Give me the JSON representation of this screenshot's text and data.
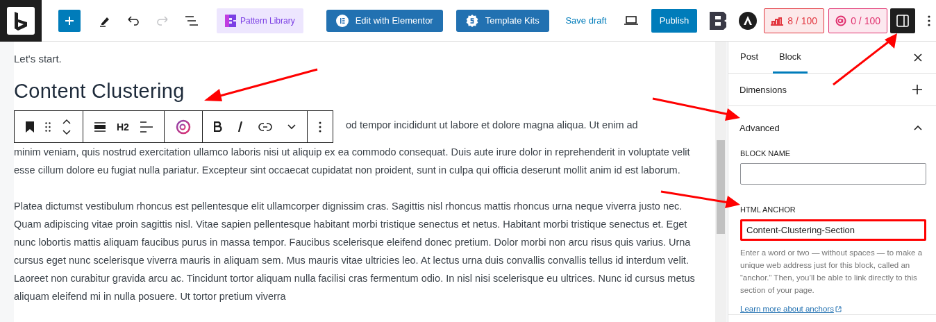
{
  "top_bar": {
    "pattern_library": "Pattern Library",
    "edit_with_elementor": "Edit with Elementor",
    "template_kits": "Template Kits",
    "save_draft": "Save draft",
    "publish": "Publish",
    "redo": {
      "disabled": true
    },
    "scores": [
      {
        "label": "8 / 100",
        "color": "#e2363f"
      },
      {
        "label": "0 / 100",
        "color": "#e0306e"
      }
    ],
    "settings_toggle": {
      "selected": true
    }
  },
  "editor": {
    "intro": "Let's start.",
    "heading": "Content Clustering",
    "block_toolbar": {
      "heading_level": "H2"
    },
    "text_beside_toolbar": "od tempor incididunt ut labore et dolore magna aliqua. Ut enim ad",
    "paragraphs": [
      "minim veniam, quis nostrud exercitation ullamco laboris nisi ut aliquip ex ea commodo consequat. Duis aute irure dolor in reprehenderit in voluptate velit esse cillum dolore eu fugiat nulla pariatur. Excepteur sint occaecat cupidatat non proident, sunt in culpa qui officia deserunt mollit anim id est laborum.",
      "Platea dictumst vestibulum rhoncus est pellentesque elit ullamcorper dignissim cras. Sagittis nisl rhoncus mattis rhoncus urna neque viverra justo nec. Quam adipiscing vitae proin sagittis nisl. Vitae sapien pellentesque habitant morbi tristique senectus et netus. Habitant morbi tristique senectus et. Eget nunc lobortis mattis aliquam faucibus purus in massa tempor. Faucibus scelerisque eleifend donec pretium. Dolor morbi non arcu risus quis varius. Urna cursus eget nunc scelerisque viverra mauris in aliquam sem. Mus mauris vitae ultricies leo. At lectus urna duis convallis convallis tellus id interdum velit. Laoreet non curabitur gravida arcu ac. Tincidunt tortor aliquam nulla facilisi cras fermentum odio. In nisl nisi scelerisque eu ultrices. Nunc id cursus metus aliquam eleifend mi in nulla posuere. Ut tortor pretium viverra"
    ]
  },
  "sidebar": {
    "tabs": [
      {
        "label": "Post",
        "selected": false
      },
      {
        "label": "Block",
        "selected": true
      }
    ],
    "panels": [
      {
        "title": "Dimensions",
        "expanded": false
      },
      {
        "title": "Advanced",
        "expanded": true,
        "fields": [
          {
            "label": "BLOCK NAME"
          },
          {
            "label": "HTML ANCHOR",
            "value": "Content-Clustering-Section",
            "highlighted": true
          }
        ],
        "help": "Enter a word or two — without spaces — to make a unique web address just for this block, called an “anchor.” Then, you’ll be able to link directly to this section of your page.",
        "link": "Learn more about anchors"
      }
    ]
  }
}
